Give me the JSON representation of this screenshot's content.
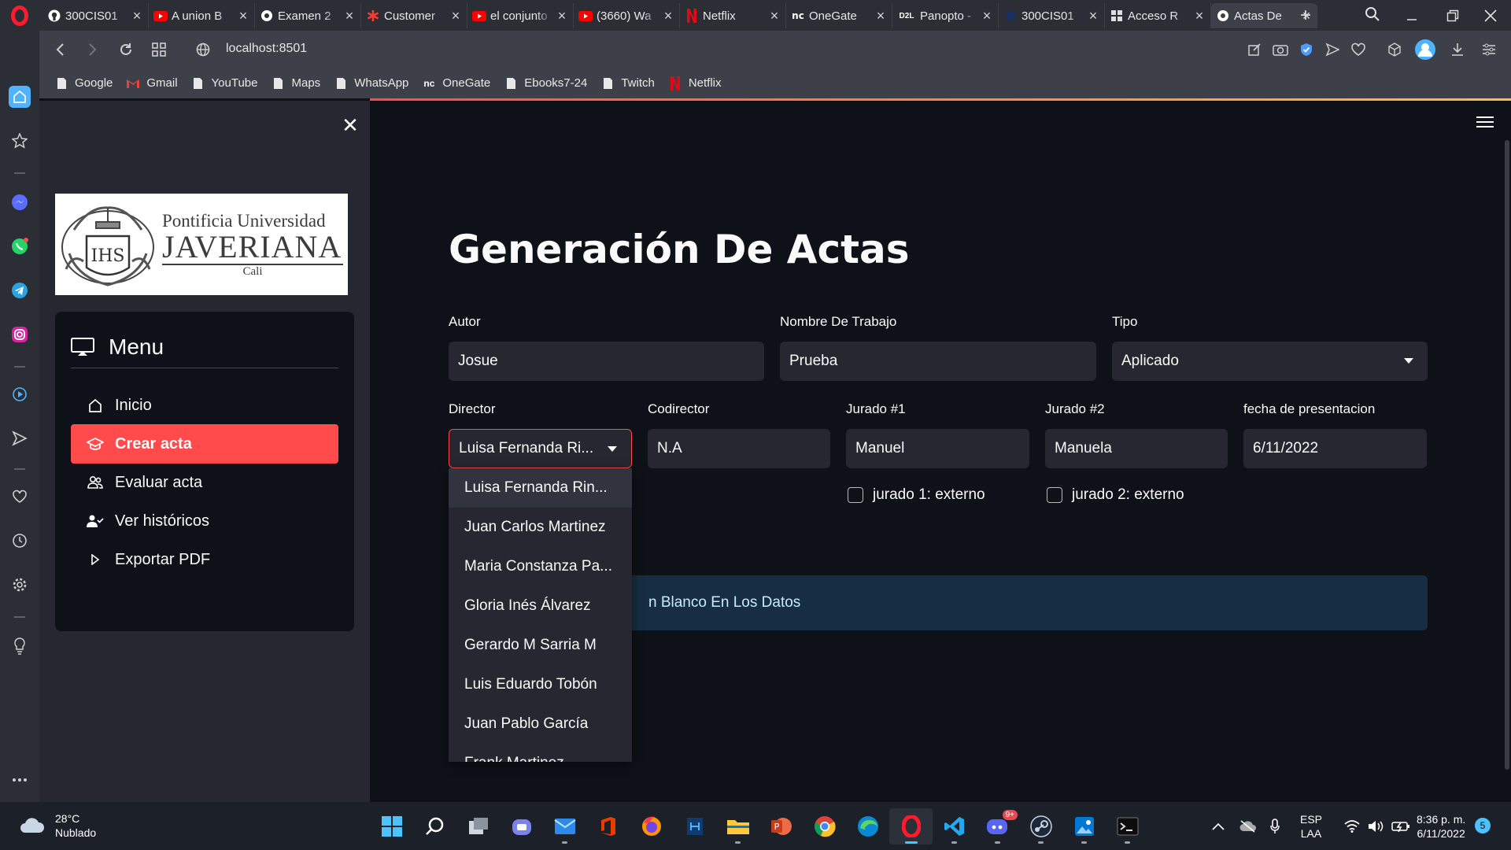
{
  "browser": {
    "tabs": [
      {
        "title": "300CIS01",
        "icon": "github-icon"
      },
      {
        "title": "A union B",
        "icon": "youtube-icon"
      },
      {
        "title": "Examen 2",
        "icon": "globe-icon"
      },
      {
        "title": "Customer",
        "icon": "asterisk-icon"
      },
      {
        "title": "el conjunto",
        "icon": "youtube-icon"
      },
      {
        "title": "(3660) Wa",
        "icon": "youtube-icon"
      },
      {
        "title": "Netflix",
        "icon": "netflix-icon"
      },
      {
        "title": "OneGate",
        "icon": "onegate-icon"
      },
      {
        "title": "Panopto -",
        "icon": "d2l-icon"
      },
      {
        "title": "300CIS01",
        "icon": "d2l-icon"
      },
      {
        "title": "Acceso R",
        "icon": "apps-icon"
      },
      {
        "title": "Actas De",
        "icon": "globe-icon",
        "active": true
      }
    ],
    "d2l_label": "D2L",
    "url": "localhost:8501",
    "bookmarks": [
      {
        "label": "Google",
        "icon": "page-icon"
      },
      {
        "label": "Gmail",
        "icon": "gmail-icon"
      },
      {
        "label": "YouTube",
        "icon": "page-icon"
      },
      {
        "label": "Maps",
        "icon": "page-icon"
      },
      {
        "label": "WhatsApp",
        "icon": "page-icon"
      },
      {
        "label": "OneGate",
        "icon": "onegate-icon"
      },
      {
        "label": "Ebooks7-24",
        "icon": "page-icon"
      },
      {
        "label": "Twitch",
        "icon": "page-icon"
      },
      {
        "label": "Netflix",
        "icon": "netflix-icon"
      }
    ],
    "onegate_mark": "nc"
  },
  "sidebar": {
    "logo": {
      "line1": "Pontificia Universidad",
      "line2": "JAVERIANA",
      "line3": "Cali",
      "crest_text": "IHS"
    },
    "menu_title": "Menu",
    "items": [
      {
        "label": "Inicio",
        "icon": "home-icon"
      },
      {
        "label": "Crear acta",
        "icon": "graduation-cap-icon",
        "active": true
      },
      {
        "label": "Evaluar acta",
        "icon": "people-icon"
      },
      {
        "label": "Ver históricos",
        "icon": "person-check-icon"
      },
      {
        "label": "Exportar PDF",
        "icon": "play-icon"
      }
    ]
  },
  "main": {
    "title": "Generación De Actas",
    "fields": {
      "autor": {
        "label": "Autor",
        "value": "Josue"
      },
      "nombre": {
        "label": "Nombre De Trabajo",
        "value": "Prueba"
      },
      "tipo": {
        "label": "Tipo",
        "value": "Aplicado"
      },
      "director": {
        "label": "Director",
        "value": "Luisa Fernanda Ri..."
      },
      "codirector": {
        "label": "Codirector",
        "value": "N.A"
      },
      "jurado1": {
        "label": "Jurado #1",
        "value": "Manuel"
      },
      "jurado2": {
        "label": "Jurado #2",
        "value": "Manuela"
      },
      "fecha": {
        "label": "fecha de presentacion",
        "value": "6/11/2022"
      }
    },
    "checkboxes": {
      "jurado1_externo": {
        "label": "jurado 1: externo",
        "checked": false
      },
      "jurado2_externo": {
        "label": "jurado 2: externo",
        "checked": false
      }
    },
    "info_message": "n Blanco En Los Datos",
    "director_options": [
      "Luisa Fernanda Rin...",
      "Juan Carlos Martinez",
      "Maria Constanza Pa...",
      "Gloria Inés Álvarez",
      "Gerardo M Sarria M",
      "Luis Eduardo Tobón",
      "Juan Pablo García",
      "Frank Martinez"
    ]
  },
  "taskbar": {
    "weather": {
      "temp": "28°C",
      "desc": "Nublado"
    },
    "lang": {
      "top": "ESP",
      "bottom": "LAA"
    },
    "clock": {
      "time": "8:36 p. m.",
      "date": "6/11/2022"
    },
    "notifications": "5",
    "discord_badge": "9+",
    "apps": [
      "windows-start-icon",
      "search-icon",
      "task-view-icon",
      "teams-icon",
      "mail-icon",
      "office-icon",
      "firefox-icon",
      "code-editor-icon",
      "file-explorer-icon",
      "powerpoint-icon",
      "chrome-icon",
      "edge-icon",
      "opera-icon",
      "vscode-icon",
      "discord-icon",
      "steam-icon",
      "photos-icon",
      "terminal-icon"
    ]
  },
  "colors": {
    "accent": "#ff4b4b",
    "app_bg": "#0e1117",
    "sidebar_bg": "#262730",
    "input_bg": "#262730",
    "info_bg": "#172d43",
    "info_text": "#c7ebff",
    "opera_red": "#ff1b2d"
  }
}
